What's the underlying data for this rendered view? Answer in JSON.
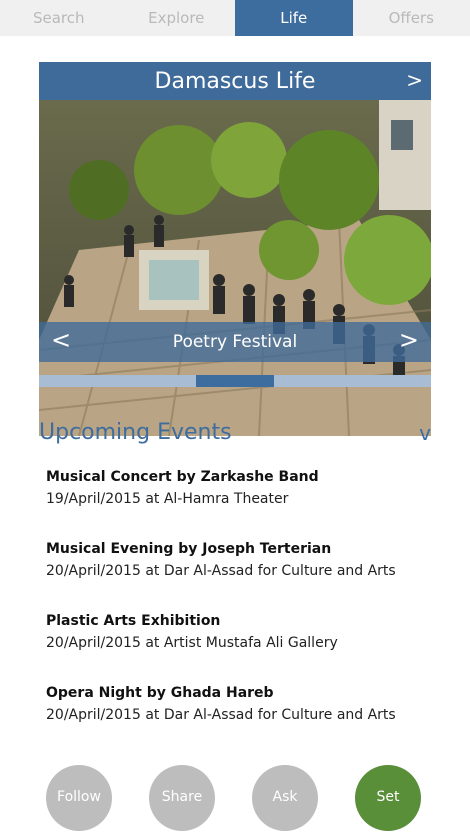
{
  "tabs": [
    {
      "label": "Search",
      "active": false
    },
    {
      "label": "Explore",
      "active": false
    },
    {
      "label": "Life",
      "active": true
    },
    {
      "label": "Offers",
      "active": false
    }
  ],
  "featured": {
    "title": "Damascus Life",
    "next_icon": ">",
    "caption": "Poetry Festival",
    "caption_prev_icon": "<",
    "caption_next_icon": ">",
    "slide_index": 2,
    "slide_count": 5
  },
  "upcoming": {
    "title": "Upcoming Events",
    "toggle_icon": "v",
    "events": [
      {
        "title": "Musical Concert by Zarkashe Band",
        "detail": "19/April/2015 at Al-Hamra Theater"
      },
      {
        "title": "Musical Evening by Joseph Terterian",
        "detail": "20/April/2015 at Dar Al-Assad for Culture and Arts"
      },
      {
        "title": "Plastic Arts Exhibition",
        "detail": "20/April/2015 at Artist Mustafa Ali Gallery"
      },
      {
        "title": "Opera Night by Ghada Hareb",
        "detail": "20/April/2015 at Dar Al-Assad for Culture and Arts"
      }
    ]
  },
  "actions": [
    {
      "label": "Follow"
    },
    {
      "label": "Share"
    },
    {
      "label": "Ask"
    },
    {
      "label": "Set"
    }
  ],
  "colors": {
    "accent": "#3d6c9f",
    "tab_inactive_text": "#b9b9b9",
    "action_gray": "#bdbdbd",
    "action_green": "#5a8f3a"
  }
}
